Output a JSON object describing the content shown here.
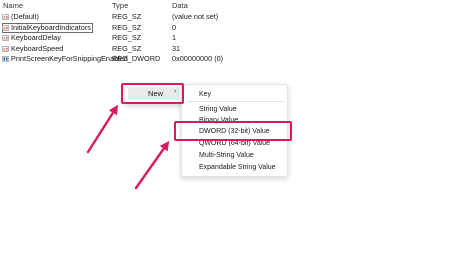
{
  "list": {
    "columns": {
      "name": "Name",
      "type": "Type",
      "data": "Data"
    },
    "rows": [
      {
        "icon": "string-value-icon",
        "name": "(Default)",
        "type": "REG_SZ",
        "data": "(value not set)"
      },
      {
        "icon": "string-value-icon",
        "name": "InitialKeyboardIndicators",
        "type": "REG_SZ",
        "data": "0"
      },
      {
        "icon": "string-value-icon",
        "name": "KeyboardDelay",
        "type": "REG_SZ",
        "data": "1"
      },
      {
        "icon": "string-value-icon",
        "name": "KeyboardSpeed",
        "type": "REG_SZ",
        "data": "31"
      },
      {
        "icon": "dword-value-icon",
        "name": "PrintScreenKeyForSnippingEnabled",
        "type": "REG_DWORD",
        "data": "0x00000000 (0)"
      }
    ]
  },
  "context_menu": {
    "new_label": "New",
    "new_arrow": "›"
  },
  "submenu": {
    "items": [
      "Key",
      "String Value",
      "Binary Value",
      "DWORD (32-bit) Value",
      "QWORD (64-bit) Value",
      "Multi-String Value",
      "Expandable String Value"
    ]
  },
  "colors": {
    "highlight": "#d81b60",
    "menu_hover": "#eaeaea",
    "string_icon": "#c0392b",
    "dword_icon": "#2c6fb7"
  }
}
